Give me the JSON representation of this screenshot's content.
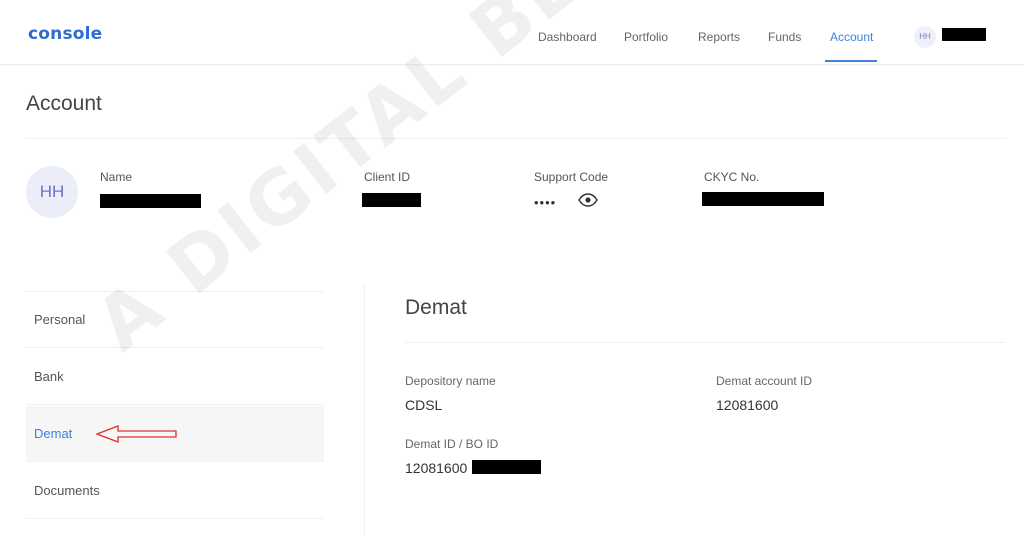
{
  "header": {
    "logo": "console",
    "nav": [
      {
        "label": "Dashboard"
      },
      {
        "label": "Portfolio"
      },
      {
        "label": "Reports"
      },
      {
        "label": "Funds"
      },
      {
        "label": "Account"
      }
    ],
    "active_nav": "Account",
    "avatar_initials": "HH"
  },
  "page": {
    "title": "Account"
  },
  "profile": {
    "initials": "HH",
    "fields": {
      "name_label": "Name",
      "client_id_label": "Client ID",
      "support_code_label": "Support Code",
      "support_code_masked": "••••",
      "ckyc_label": "CKYC No."
    }
  },
  "sidebar": {
    "items": [
      {
        "label": "Personal"
      },
      {
        "label": "Bank"
      },
      {
        "label": "Demat"
      },
      {
        "label": "Documents"
      }
    ],
    "active": "Demat"
  },
  "demat": {
    "title": "Demat",
    "depository_label": "Depository name",
    "depository_value": "CDSL",
    "account_id_label": "Demat account ID",
    "account_id_value": "12081600",
    "bo_id_label": "Demat ID / BO ID",
    "bo_id_value": "12081600"
  },
  "watermark": "A DIGITAL BLOGGER",
  "colors": {
    "accent": "#3f7fe0",
    "logo": "#2f6cd0",
    "arrow": "#e03030"
  }
}
